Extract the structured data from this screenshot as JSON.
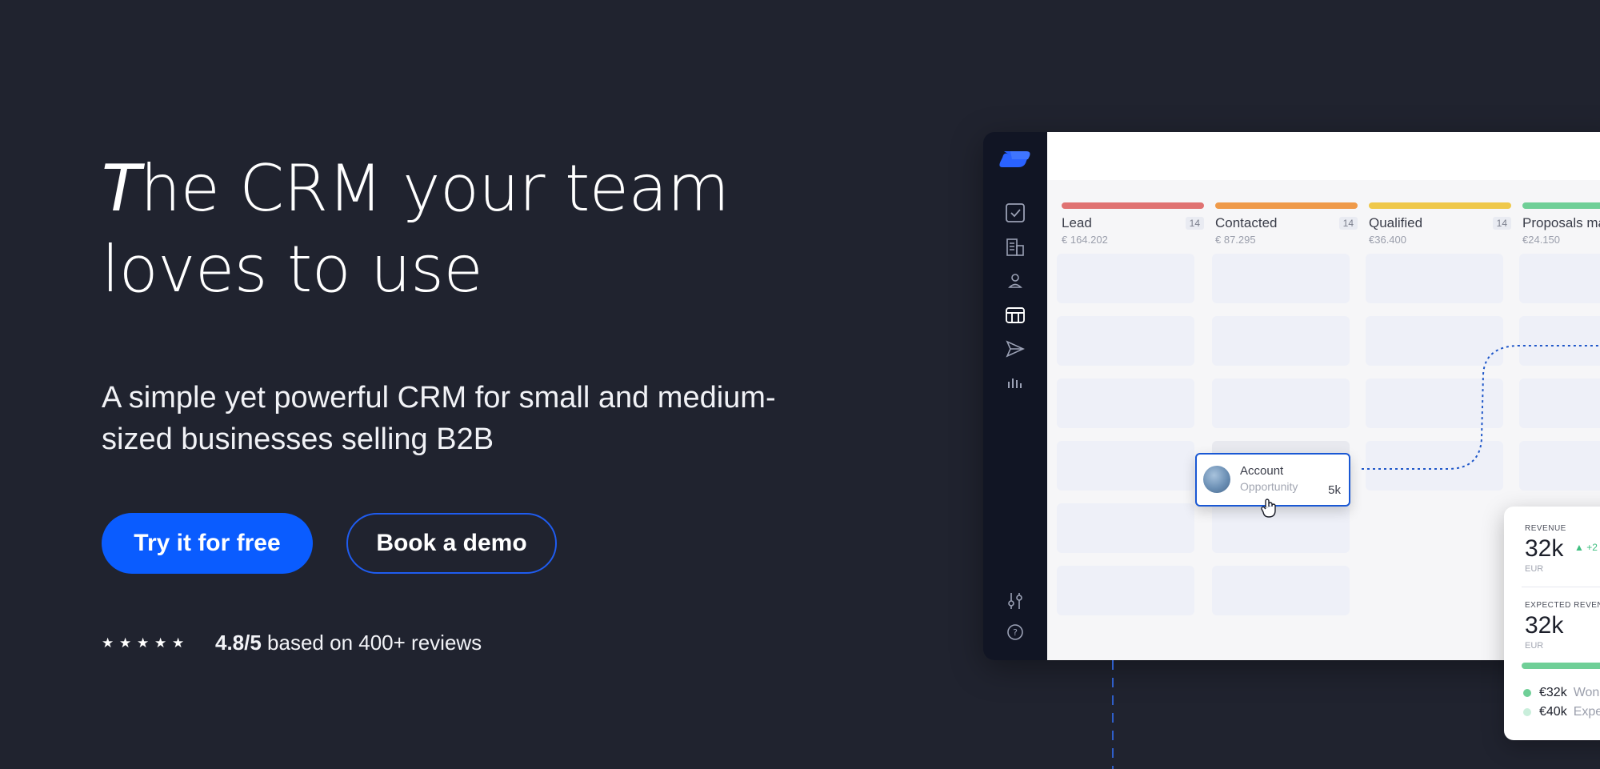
{
  "hero": {
    "headline_first_letter": "T",
    "headline_line1_rest": "he CRM your team",
    "headline_line2": "loves to use",
    "subtitle": "A simple yet powerful CRM for small and medium-sized businesses selling B2B",
    "cta_primary": "Try it for free",
    "cta_secondary": "Book a demo",
    "rating_value": "4.8/5",
    "rating_text": " based on 400+ reviews",
    "stars": 5
  },
  "app": {
    "sidebar_icons": [
      "logo",
      "check-square-icon",
      "buildings-icon",
      "person-icon",
      "pipeline-board-icon",
      "send-icon",
      "bar-chart-icon",
      "settings-sliders-icon",
      "help-icon"
    ],
    "columns": [
      {
        "title": "Lead",
        "count": "14",
        "value": "€ 164.202",
        "color": "#e07272"
      },
      {
        "title": "Contacted",
        "count": "14",
        "value": "€ 87.295",
        "color": "#ef9a4a"
      },
      {
        "title": "Qualified",
        "count": "14",
        "value": "€36.400",
        "color": "#efc84a"
      },
      {
        "title": "Proposals ma",
        "count": "",
        "value": "€24.150",
        "color": "#6fcf97"
      }
    ],
    "account_card": {
      "title": "Account",
      "subtitle": "Opportunity",
      "value": "5k"
    },
    "revenue_card": {
      "revenue_label": "REVENUE",
      "revenue_value": "32k",
      "revenue_unit": "EUR",
      "revenue_delta": "+2",
      "expected_label": "EXPECTED REVENU",
      "expected_value": "32k",
      "expected_unit": "EUR",
      "progress_fraction": 1.0,
      "legend_won_value": "€32k",
      "legend_won_label": "Won",
      "legend_expected_value": "€40k",
      "legend_expected_label": "Expe"
    }
  },
  "colors": {
    "background": "#20232f",
    "accent": "#0a5cff",
    "sidebar": "#111524"
  }
}
